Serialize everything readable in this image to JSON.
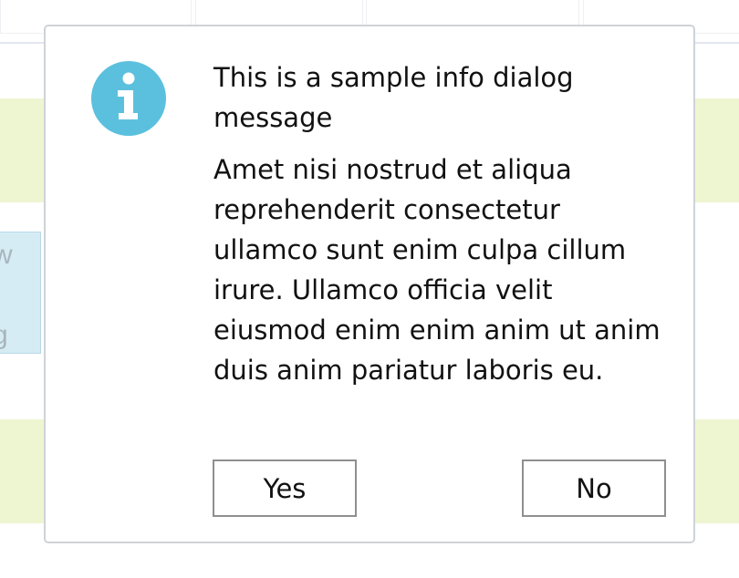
{
  "background": {
    "card_visible_chars": [
      "w",
      "g"
    ]
  },
  "dialog": {
    "icon": "info-icon",
    "title": "This is a sample info dialog message",
    "message": "Amet nisi nostrud et aliqua reprehenderit consectetur ullamco sunt enim culpa cillum irure. Ullamco officia velit eiusmod enim enim anim ut anim duis anim pariatur laboris eu.",
    "buttons": {
      "yes": "Yes",
      "no": "No"
    }
  },
  "colors": {
    "info_icon": "#5bc0de",
    "highlight_band": "#eef5d1",
    "card_background": "#d5ecf4",
    "dialog_border": "#cfd3d8",
    "button_border": "#8f8f8f"
  }
}
